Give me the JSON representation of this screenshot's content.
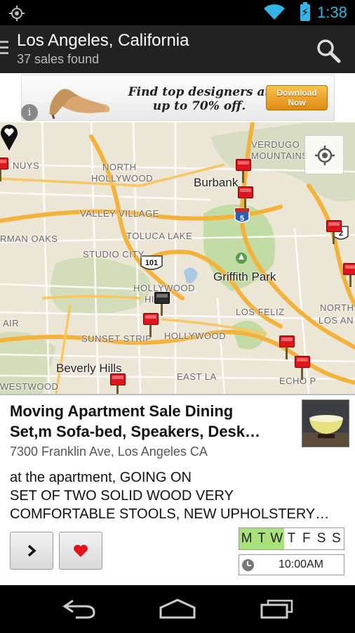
{
  "status_bar": {
    "time": "1:38",
    "icons": [
      "gps-icon",
      "wifi-icon",
      "battery-charging-icon"
    ]
  },
  "action_bar": {
    "title": "Los Angeles, California",
    "subtitle": "37 sales found",
    "icons": [
      "drawer-icon",
      "search-icon"
    ]
  },
  "ad": {
    "text_line1": "Find top designers at",
    "text_line2": "up to 70% off.",
    "button_line1": "Download",
    "button_line2": "Now",
    "info_glyph": "i"
  },
  "map": {
    "labels": [
      {
        "text": "N NUYS",
        "kind": "small"
      },
      {
        "text": "NORTH",
        "kind": "small"
      },
      {
        "text": "HOLLYWOOD",
        "kind": "small"
      },
      {
        "text": "VERDUGO",
        "kind": "small"
      },
      {
        "text": "MOUNTAINS",
        "kind": "small"
      },
      {
        "text": "Burbank",
        "kind": "big"
      },
      {
        "text": "VALLEY VILLAGE",
        "kind": "small"
      },
      {
        "text": "RMAN OAKS",
        "kind": "small"
      },
      {
        "text": "TOLUCA LAKE",
        "kind": "small"
      },
      {
        "text": "STUDIO CITY",
        "kind": "small"
      },
      {
        "text": "Griffith Park",
        "kind": "big"
      },
      {
        "text": "HOLLYWOOD",
        "kind": "small"
      },
      {
        "text": "HI",
        "kind": "small"
      },
      {
        "text": "LOS FELIZ",
        "kind": "small"
      },
      {
        "text": "NORTH",
        "kind": "small"
      },
      {
        "text": "LOS AN",
        "kind": "small"
      },
      {
        "text": "AIR",
        "kind": "small"
      },
      {
        "text": "SUNSET STRIP",
        "kind": "small"
      },
      {
        "text": "HOLLYWOOD",
        "kind": "small"
      },
      {
        "text": "ECHO P",
        "kind": "small"
      },
      {
        "text": "Beverly Hills",
        "kind": "big"
      },
      {
        "text": "WESTWOOD",
        "kind": "small"
      },
      {
        "text": "EAST LA",
        "kind": "small"
      }
    ],
    "shields": [
      "5",
      "101",
      "2"
    ]
  },
  "listing": {
    "title_line1": "Moving Apartment Sale Dining",
    "title_line2": "Set,m Sofa-bed, Speakers, Desk…",
    "address": "7300 Franklin Ave, Los Angeles CA",
    "desc_line1": "at the apartment, GOING ON",
    "desc_line2": "SET OF TWO SOLID WOOD VERY",
    "desc_line3": "COMFORTABLE STOOLS, NEW UPHOLSTERY…",
    "days": [
      {
        "label": "M",
        "active": true
      },
      {
        "label": "T",
        "active": true
      },
      {
        "label": "W",
        "active": true
      },
      {
        "label": "T",
        "active": false
      },
      {
        "label": "F",
        "active": false
      },
      {
        "label": "S",
        "active": false
      },
      {
        "label": "S",
        "active": false
      }
    ],
    "time": "10:00AM",
    "active_day_color": "#a9e27a",
    "favorite_color": "#e3121b"
  },
  "nav_bar": {
    "icons": [
      "back-icon",
      "home-icon",
      "recent-apps-icon"
    ]
  },
  "colors": {
    "accent": "#33b5e5",
    "pin_red": "#e0141b",
    "road_orange": "#f4b23a",
    "park_green": "#c3dba5"
  }
}
